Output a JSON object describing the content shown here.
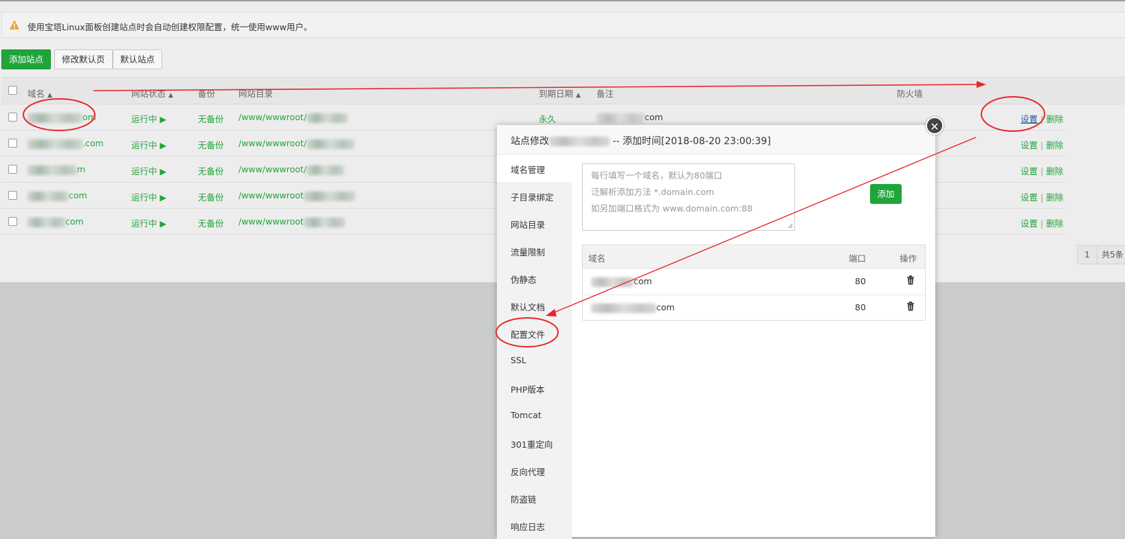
{
  "notice": {
    "text": "使用宝塔Linux面板创建站点时会自动创建权限配置，统一使用www用户。"
  },
  "toolbar": {
    "add_site": "添加站点",
    "edit_default_page": "修改默认页",
    "default_site": "默认站点"
  },
  "table": {
    "headers": {
      "domain": "域名",
      "status": "网站状态",
      "backup": "备份",
      "root": "网站目录",
      "expire": "到期日期",
      "remark": "备注",
      "firewall": "防火墙"
    },
    "rows": [
      {
        "domain_suffix": "om",
        "status": "运行中 ▶",
        "backup": "无备份",
        "root": "/www/wwwroot/",
        "expire": "永久",
        "remark_suffix": "com",
        "set": "设置",
        "sep": "|",
        "delete": "删除"
      },
      {
        "domain_suffix": ".com",
        "status": "运行中 ▶",
        "backup": "无备份",
        "root": "/www/wwwroot/",
        "expire": "",
        "remark_suffix": "",
        "set": "设置",
        "sep": "|",
        "delete": "删除"
      },
      {
        "domain_suffix": "m",
        "status": "运行中 ▶",
        "backup": "无备份",
        "root": "/www/wwwroot/",
        "expire": "",
        "remark_suffix": "",
        "set": "设置",
        "sep": "|",
        "delete": "删除"
      },
      {
        "domain_suffix": "com",
        "status": "运行中 ▶",
        "backup": "无备份",
        "root": "/www/wwwroot",
        "expire": "",
        "remark_suffix": "",
        "set": "设置",
        "sep": "|",
        "delete": "删除"
      },
      {
        "domain_suffix": "com",
        "status": "运行中 ▶",
        "backup": "无备份",
        "root": "/www/wwwroot",
        "expire": "",
        "remark_suffix": "",
        "set": "设置",
        "sep": "|",
        "delete": "删除"
      }
    ]
  },
  "pager": {
    "page": "1",
    "total": "共5条"
  },
  "modal": {
    "title_prefix": "站点修改",
    "title_suffix": "-- 添加时间[2018-08-20 23:00:39]",
    "close": "✕",
    "menu": [
      "域名管理",
      "子目录绑定",
      "网站目录",
      "流量限制",
      "伪静态",
      "默认文档",
      "配置文件",
      "SSL",
      "PHP版本",
      "Tomcat",
      "301重定向",
      "反向代理",
      "防盗链",
      "响应日志"
    ],
    "placeholder_lines": [
      "每行填写一个域名，默认为80端口",
      "泛解析添加方法 *.domain.com",
      "如另加端口格式为 www.domain.com:88"
    ],
    "add_button": "添加",
    "domain_table": {
      "headers": {
        "domain": "域名",
        "port": "端口",
        "action": "操作"
      },
      "rows": [
        {
          "domain_suffix": "com",
          "port": "80"
        },
        {
          "domain_suffix": "com",
          "port": "80"
        }
      ]
    }
  },
  "colors": {
    "accent": "#20a53a",
    "annotation": "#e8252a"
  }
}
